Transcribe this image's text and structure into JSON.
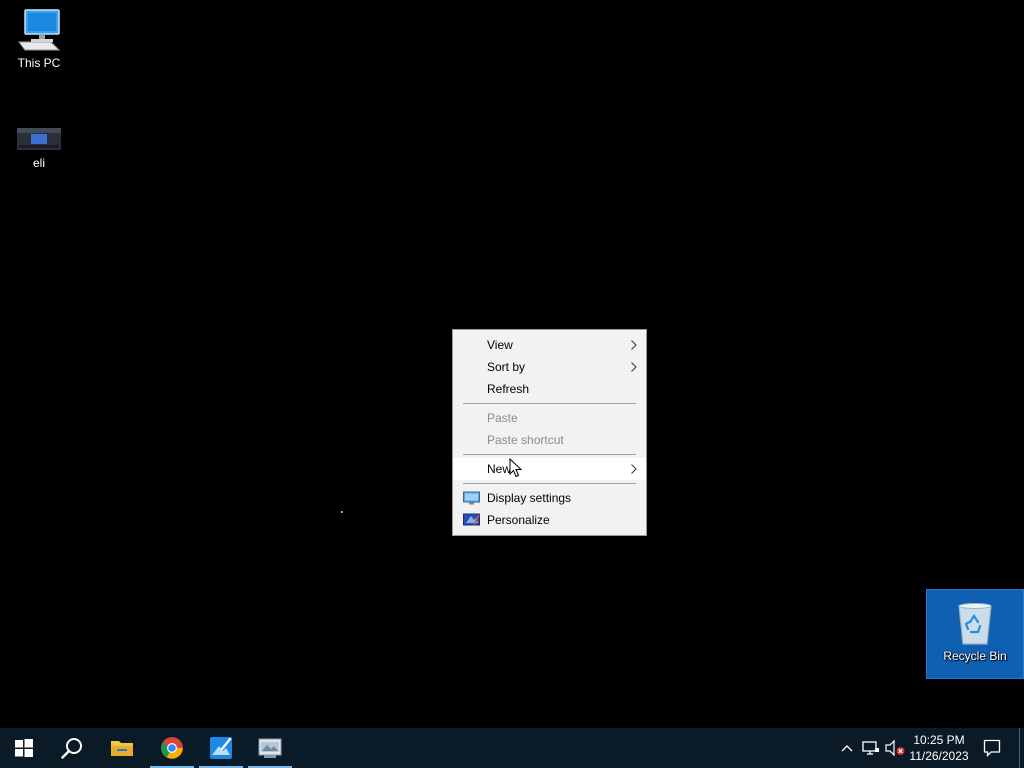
{
  "desktop": {
    "icons": [
      {
        "label": "This PC",
        "icon": "computer-icon"
      },
      {
        "label": "eli",
        "icon": "shortcut-thumbnail-icon"
      },
      {
        "label": "Recycle Bin",
        "icon": "recycle-bin-icon"
      }
    ]
  },
  "context_menu": {
    "items": [
      {
        "label": "View",
        "has_submenu": true,
        "enabled": true
      },
      {
        "label": "Sort by",
        "has_submenu": true,
        "enabled": true
      },
      {
        "label": "Refresh",
        "enabled": true
      },
      {
        "label": "Paste",
        "enabled": false
      },
      {
        "label": "Paste shortcut",
        "enabled": false
      },
      {
        "label": "New",
        "has_submenu": true,
        "enabled": true,
        "highlighted": true
      },
      {
        "label": "Display settings",
        "icon": "display-icon",
        "enabled": true
      },
      {
        "label": "Personalize",
        "icon": "personalize-icon",
        "enabled": true
      }
    ]
  },
  "taskbar": {
    "buttons": [
      {
        "name": "start",
        "icon": "windows-logo-icon"
      },
      {
        "name": "search",
        "icon": "search-icon"
      },
      {
        "name": "file-explorer",
        "icon": "folder-icon"
      },
      {
        "name": "chrome",
        "icon": "chrome-icon",
        "running": true
      },
      {
        "name": "paint",
        "icon": "paint-icon",
        "running": true
      },
      {
        "name": "app",
        "icon": "app-window-icon",
        "running": true
      }
    ],
    "clock": {
      "time": "10:25 PM",
      "date": "11/26/2023"
    },
    "tray_icons": [
      "chevron-up-icon",
      "network-icon",
      "volume-muted-icon",
      "notification-icon"
    ]
  },
  "colors": {
    "desktop_bg": "#000000",
    "taskbar_bg": "#0a1a26",
    "menu_bg": "#f2f2f2",
    "selection_blue": "#0f5fb3",
    "active_indicator": "#76b9ed"
  }
}
